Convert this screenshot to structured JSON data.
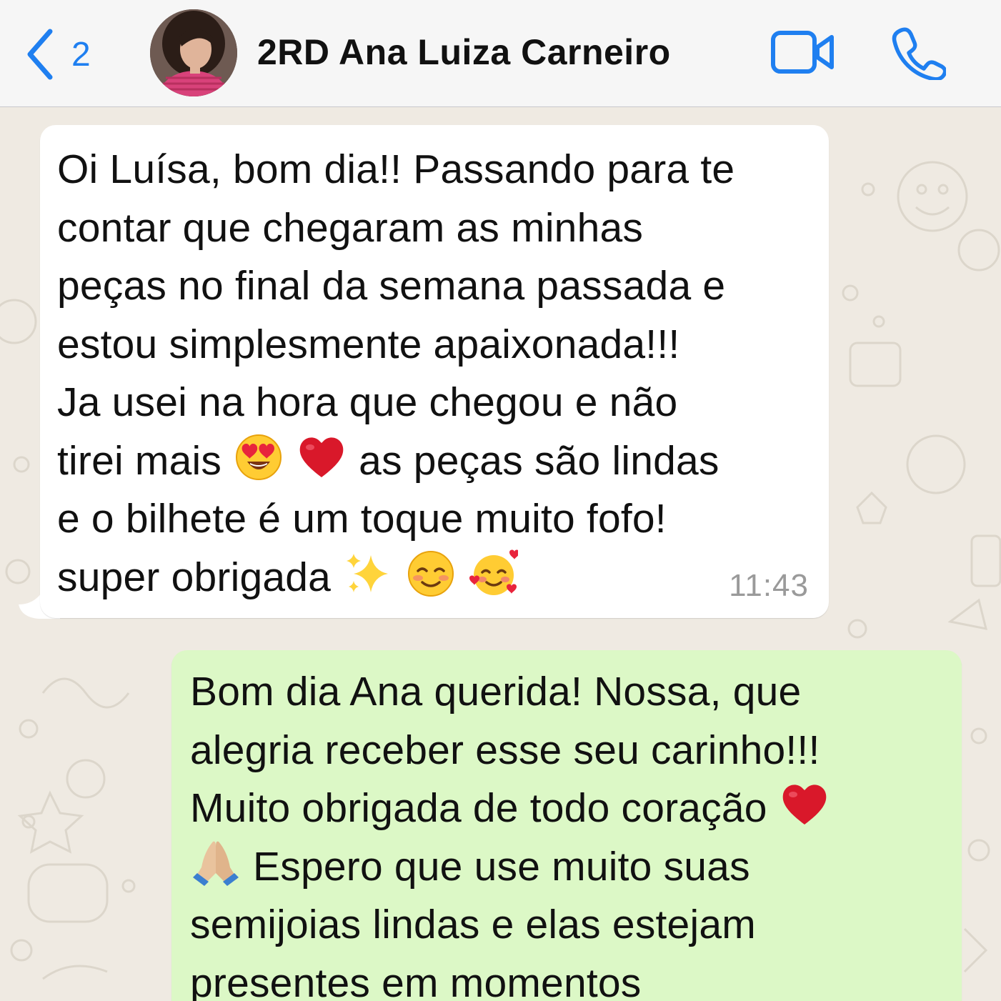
{
  "header": {
    "back_count": "2",
    "contact_name": "2RD Ana Luiza Carneiro",
    "accent_color": "#1f7ff0"
  },
  "messages": {
    "incoming": {
      "lines": [
        "Oi Luísa, bom dia!! Passando para te",
        "contar que chegaram as minhas",
        "peças no final da semana passada e",
        "estou simplesmente apaixonada!!!",
        "Ja usei na hora que chegou e não"
      ],
      "line6_before": "tirei mais",
      "line6_after": "as peças são lindas",
      "line7": "e o bilhete é um toque muito fofo!",
      "line8": "super obrigada",
      "time": "11:43",
      "bubble_color": "#ffffff"
    },
    "outgoing": {
      "line1": "Bom dia Ana querida! Nossa, que",
      "line2": "alegria receber esse seu carinho!!!",
      "line3": "Muito obrigada de todo coração",
      "line4": "Espero que use muito suas",
      "line5": "semijoias lindas e elas estejam",
      "line6": "presentes em momentos",
      "bubble_color": "#dcf8c6"
    }
  },
  "icons": {
    "back": "chevron-left-icon",
    "video": "video-camera-icon",
    "call": "phone-icon",
    "emoji_heart_eyes": "heart-eyes-emoji",
    "emoji_red_heart": "red-heart-emoji",
    "emoji_sparkles": "sparkles-emoji",
    "emoji_smiling": "smiling-blush-emoji",
    "emoji_hearts_face": "smiling-face-with-hearts-emoji",
    "emoji_folded_hands": "folded-hands-emoji"
  }
}
